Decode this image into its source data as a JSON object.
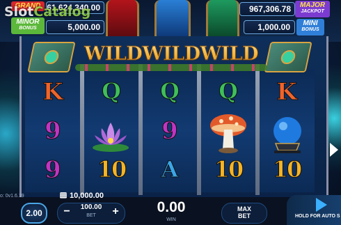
{
  "jackpots": {
    "grand": {
      "tag_line1": "GRAND",
      "tag_line2": "BONUS",
      "value": "61,624,340.00"
    },
    "minor": {
      "tag_line1": "MINOR",
      "tag_line2": "BONUS",
      "value": "5,000.00"
    },
    "major": {
      "tag_line1": "MAJOR",
      "tag_line2": "JACKPOT",
      "value": "967,306.78"
    },
    "mini": {
      "tag_line1": "MINI",
      "tag_line2": "BONUS",
      "value": "1,000.00"
    }
  },
  "watermark": {
    "part1": "Slot",
    "part2": "Catalog"
  },
  "banner": {
    "text": "WILDWILDWILD"
  },
  "reels": [
    [
      "K",
      "9",
      "9"
    ],
    [
      "Q",
      "lotus",
      "10"
    ],
    [
      "Q",
      "9",
      "A"
    ],
    [
      "Q",
      "mushroom",
      "10"
    ],
    [
      "K",
      "crystal-ball",
      "10"
    ]
  ],
  "footer": {
    "version": "o: 0v1.6.19",
    "balance": "10,000.00",
    "bet_value": "100.00",
    "bet_label": "BET",
    "win_value": "0.00",
    "win_label": "WIN",
    "speed": "2.00",
    "max_bet_line1": "MAX",
    "max_bet_line2": "BET",
    "hold_label": "HOLD FOR AUTO S",
    "minus": "−",
    "plus": "+"
  },
  "colors": {
    "accent": "#4aa6e6",
    "gold": "#f2b237",
    "grand_red": "#d8262e",
    "minor_green": "#5cb83a",
    "major_purple": "#7c3bd0",
    "mini_blue": "#2f7fd8"
  }
}
